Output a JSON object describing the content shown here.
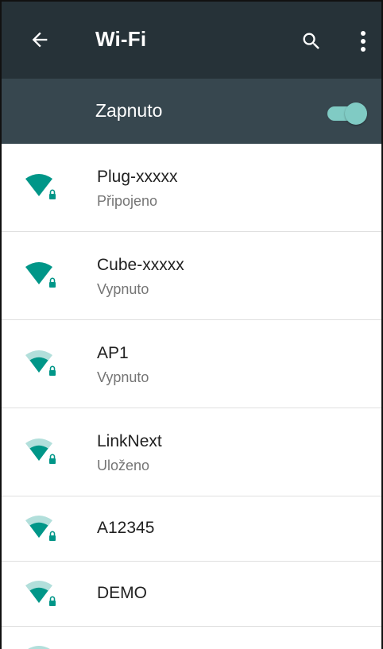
{
  "appbar": {
    "title": "Wi-Fi",
    "back_icon": "arrow-back-icon",
    "search_icon": "search-icon",
    "more_icon": "more-vert-icon"
  },
  "master_switch": {
    "label": "Zapnuto",
    "state": "on"
  },
  "colors": {
    "appbar_bg": "#263238",
    "switchbar_bg": "#37474f",
    "accent": "#009688",
    "accent_light": "#80cbc4",
    "divider": "#e0e0e0"
  },
  "networks": [
    {
      "name": "Plug-xxxxx",
      "status": "Připojeno",
      "signal": "full",
      "secured": true
    },
    {
      "name": "Cube-xxxxx",
      "status": "Vypnuto",
      "signal": "full",
      "secured": true
    },
    {
      "name": "AP1",
      "status": "Vypnuto",
      "signal": "medium",
      "secured": true
    },
    {
      "name": "LinkNext",
      "status": "Uloženo",
      "signal": "medium",
      "secured": true
    },
    {
      "name": "A12345",
      "status": "",
      "signal": "medium",
      "secured": true
    },
    {
      "name": "DEMO",
      "status": "",
      "signal": "medium",
      "secured": true
    }
  ]
}
